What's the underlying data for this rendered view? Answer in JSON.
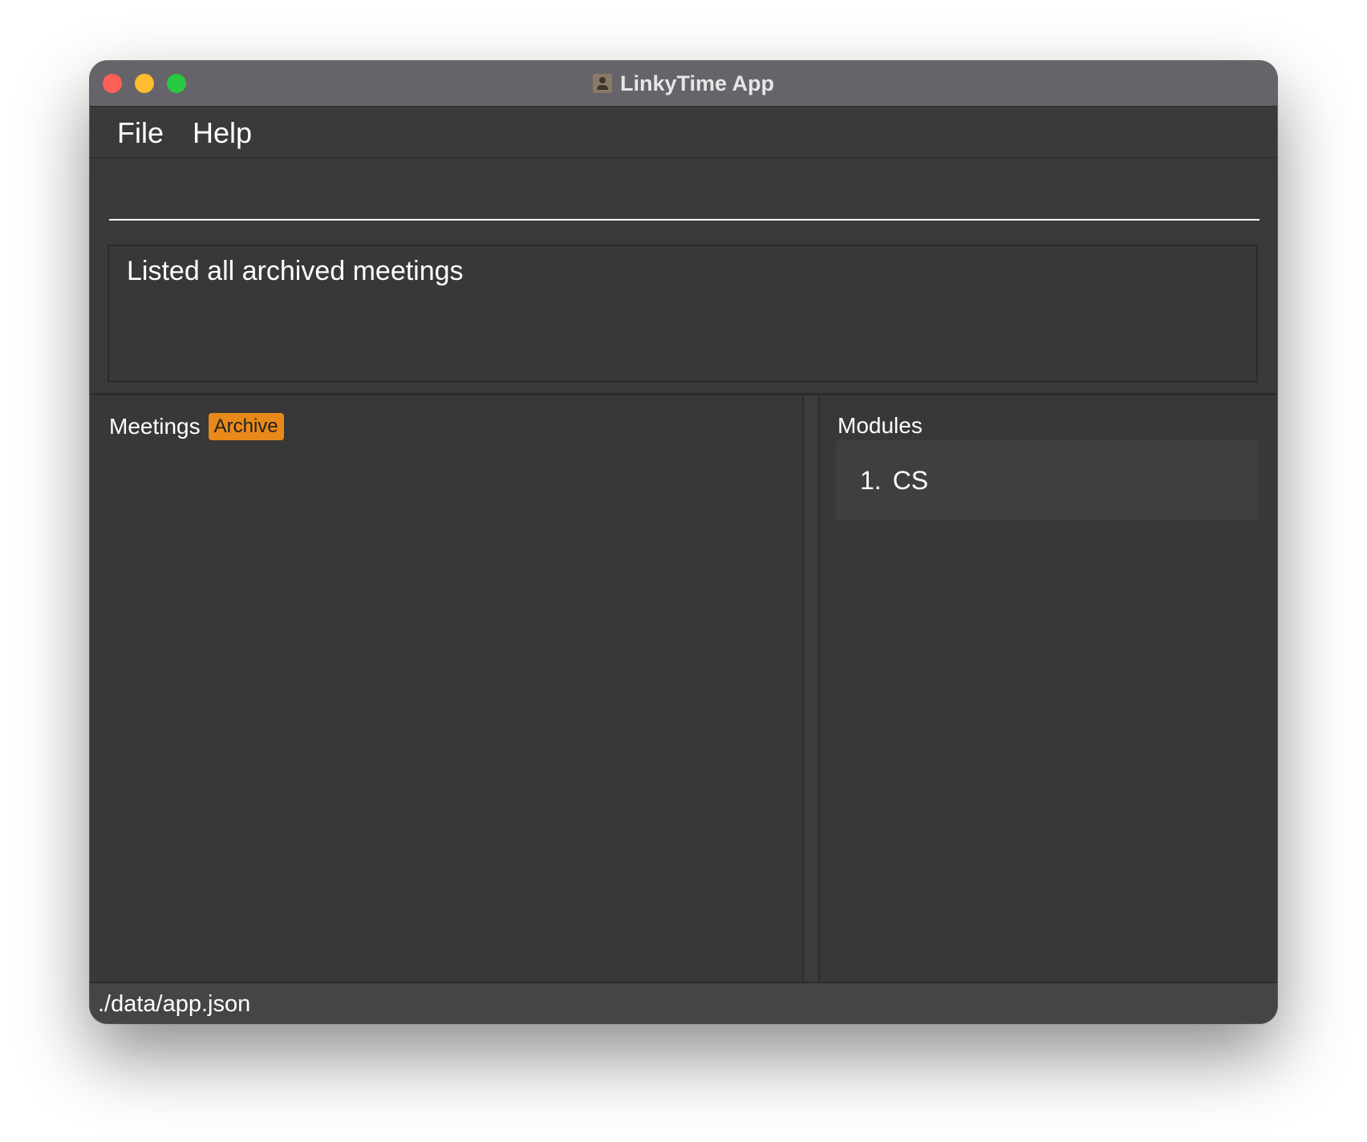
{
  "window": {
    "title": "LinkyTime App",
    "app_icon": "person-card-icon",
    "traffic_lights": {
      "close_color": "#fe5f57",
      "minimize_color": "#febc2e",
      "maximize_color": "#28c840"
    }
  },
  "menu": {
    "file_label": "File",
    "help_label": "Help"
  },
  "command_box": {
    "value": "",
    "placeholder": ""
  },
  "result_display": {
    "text": "Listed all archived meetings"
  },
  "meetings_panel": {
    "title": "Meetings",
    "badge": "Archive",
    "badge_color": "#e8891a",
    "items": []
  },
  "modules_panel": {
    "title": "Modules",
    "items": [
      {
        "index": "1.",
        "name": "CS"
      }
    ]
  },
  "status_bar": {
    "path": "./data/app.json"
  }
}
